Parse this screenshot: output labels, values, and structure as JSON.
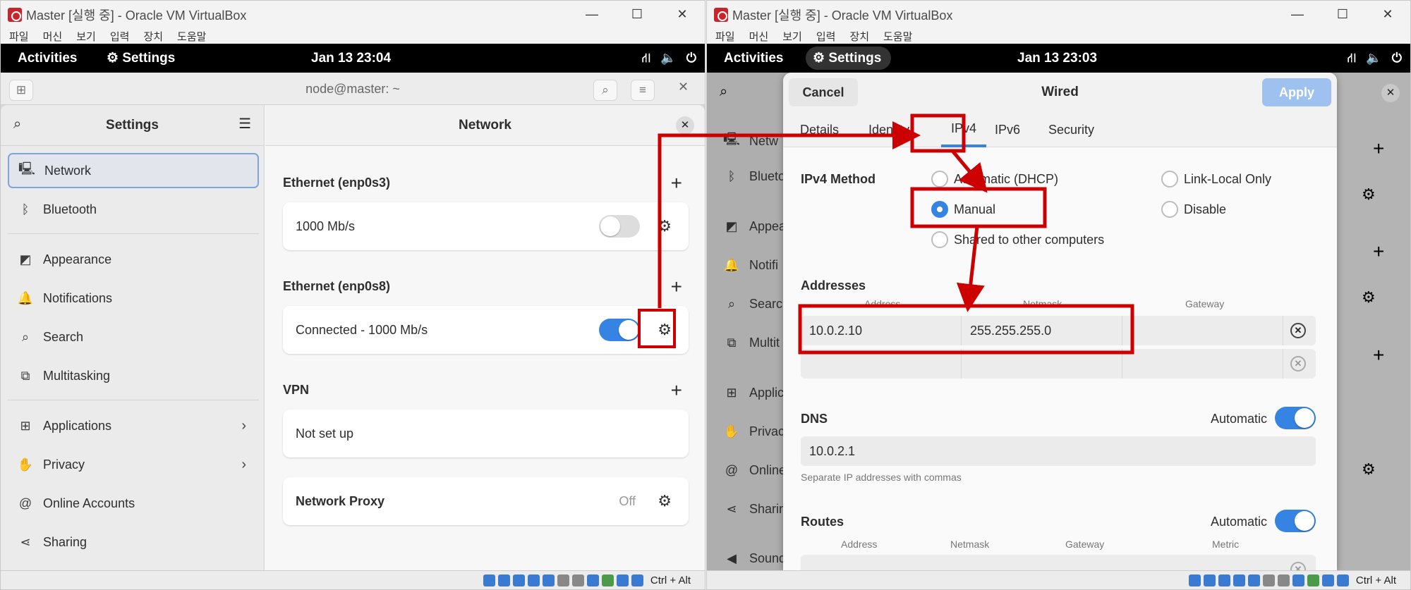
{
  "left_window": {
    "title": "Master [실행 중] - Oracle VM VirtualBox",
    "menu": [
      "파일",
      "머신",
      "보기",
      "입력",
      "장치",
      "도움말"
    ],
    "topbar": {
      "activities": "Activities",
      "app": "Settings",
      "clock": "Jan 13  23:04"
    },
    "terminal_title": "node@master: ~",
    "settings": {
      "sidebar_title": "Settings",
      "main_title": "Network",
      "sidebar_items": [
        {
          "label": "Network",
          "icon": "network-wired-icon"
        },
        {
          "label": "Bluetooth",
          "icon": "bluetooth-icon"
        },
        {
          "label": "Appearance",
          "icon": "appearance-icon"
        },
        {
          "label": "Notifications",
          "icon": "bell-icon"
        },
        {
          "label": "Search",
          "icon": "search-icon"
        },
        {
          "label": "Multitasking",
          "icon": "multitasking-icon"
        },
        {
          "label": "Applications",
          "icon": "apps-grid-icon"
        },
        {
          "label": "Privacy",
          "icon": "hand-icon"
        },
        {
          "label": "Online Accounts",
          "icon": "at-icon"
        },
        {
          "label": "Sharing",
          "icon": "share-icon"
        }
      ],
      "sections": {
        "eth1_title": "Ethernet (enp0s3)",
        "eth1_status": "1000 Mb/s",
        "eth2_title": "Ethernet (enp0s8)",
        "eth2_status": "Connected - 1000 Mb/s",
        "vpn_title": "VPN",
        "vpn_status": "Not set up",
        "proxy_label": "Network Proxy",
        "proxy_state": "Off"
      }
    },
    "statusbar": {
      "hotkey": "Ctrl + Alt"
    }
  },
  "right_window": {
    "title": "Master [실행 중] - Oracle VM VirtualBox",
    "menu": [
      "파일",
      "머신",
      "보기",
      "입력",
      "장치",
      "도움말"
    ],
    "topbar": {
      "activities": "Activities",
      "app": "Settings",
      "clock": "Jan 13  23:03"
    },
    "bg_sidebar": [
      "Netw",
      "Blueto",
      "Appea",
      "Notifi",
      "Searc",
      "Multit",
      "Applic",
      "Privac",
      "Online",
      "Sharin",
      "Sound"
    ],
    "dialog": {
      "title": "Wired",
      "cancel": "Cancel",
      "apply": "Apply",
      "tabs": [
        "Details",
        "Identity",
        "IPv4",
        "IPv6",
        "Security"
      ],
      "ipv4_method_label": "IPv4 Method",
      "methods": {
        "auto": "Automatic (DHCP)",
        "manual": "Manual",
        "shared": "Shared to other computers",
        "link_local": "Link-Local Only",
        "disable": "Disable"
      },
      "addresses_label": "Addresses",
      "col_address": "Address",
      "col_netmask": "Netmask",
      "col_gateway": "Gateway",
      "address_value": "10.0.2.10",
      "netmask_value": "255.255.255.0",
      "gateway_value": "",
      "dns_label": "DNS",
      "automatic": "Automatic",
      "dns_value": "10.0.2.1",
      "dns_hint": "Separate IP addresses with commas",
      "routes_label": "Routes",
      "routes_cols": [
        "Address",
        "Netmask",
        "Gateway",
        "Metric"
      ]
    },
    "statusbar": {
      "hotkey": "Ctrl + Alt"
    }
  },
  "accent_color": "#3584e4",
  "annotation_color": "#cc0000"
}
